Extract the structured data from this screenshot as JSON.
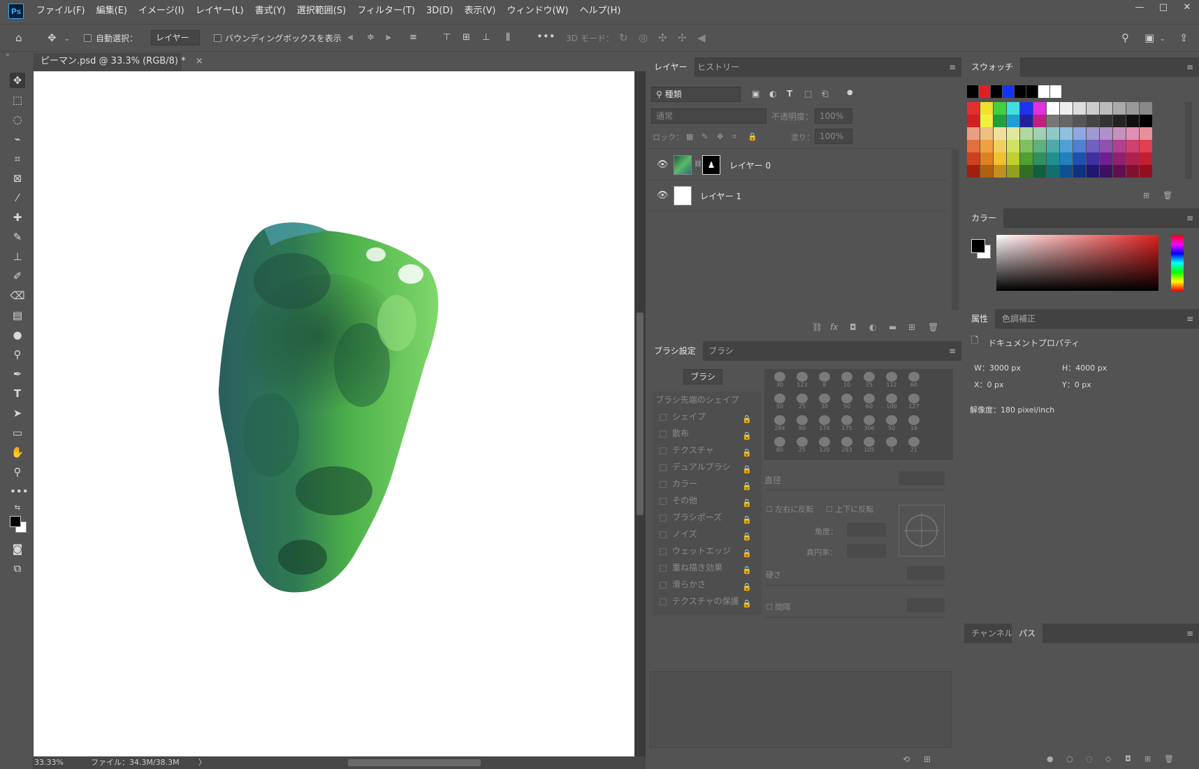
{
  "app": {
    "logo": "Ps"
  },
  "menu": [
    "ファイル(F)",
    "編集(E)",
    "イメージ(I)",
    "レイヤー(L)",
    "書式(Y)",
    "選択範囲(S)",
    "フィルター(T)",
    "3D(D)",
    "表示(V)",
    "ウィンドウ(W)",
    "ヘルプ(H)"
  ],
  "window_controls": [
    "—",
    "□",
    "✕"
  ],
  "options": {
    "auto_select_label": "自動選択：",
    "auto_select_target": "レイヤー",
    "bounding_box_label": "バウンディングボックスを表示",
    "threeD_mode_label": "3D モード："
  },
  "document": {
    "tab_title": "ピーマン.psd @ 33.3% (RGB/8) *",
    "close": "×"
  },
  "status": {
    "zoom": "33.33%",
    "file_info": "ファイル：34.3M/38.3M",
    "arrow": "〉"
  },
  "layers_panel": {
    "tabs": [
      "レイヤー",
      "ヒストリー"
    ],
    "filter_kind": "種類",
    "blend_mode": "通常",
    "opacity_label": "不透明度：",
    "opacity_value": "100%",
    "lock_label": "ロック：",
    "fill_label": "塗り：",
    "fill_value": "100%",
    "layers": [
      {
        "name": "レイヤー 0"
      },
      {
        "name": "レイヤー 1"
      }
    ]
  },
  "brush_panel": {
    "tabs": [
      "ブラシ設定",
      "ブラシ"
    ],
    "brush_button": "ブラシ",
    "tip_shape": "ブラシ先端のシェイプ",
    "options": [
      "シェイプ",
      "散布",
      "テクスチャ",
      "デュアルブラシ",
      "カラー",
      "その他",
      "ブラシポーズ",
      "ノイズ",
      "ウェットエッジ",
      "重ね描き効果",
      "滑らかさ",
      "テクスチャの保護"
    ],
    "brush_sizes": [
      "30",
      "123",
      "8",
      "10",
      "25",
      "112",
      "60",
      "50",
      "25",
      "30",
      "50",
      "60",
      "100",
      "127",
      "284",
      "80",
      "174",
      "175",
      "306",
      "50",
      "16",
      "80",
      "25",
      "120",
      "283",
      "105",
      "3",
      "21"
    ],
    "diameter_label": "直径",
    "flip_x_label": "左右に反転",
    "flip_y_label": "上下に反転",
    "angle_label": "角度：",
    "roundness_label": "真円率：",
    "hardness_label": "硬さ",
    "spacing_label": "間隔"
  },
  "swatches_panel": {
    "tab": "スウォッチ",
    "recent": [
      "#000000",
      "#e02020",
      "#000000",
      "#1432ff",
      "#000000",
      "#000000",
      "#ffffff",
      "#ffffff"
    ],
    "rows": [
      [
        "#e03030",
        "#f0e030",
        "#40d040",
        "#40e0e0",
        "#2030f0",
        "#e030e0",
        "#ffffff",
        "#eeeeee",
        "#dddddd",
        "#cccccc",
        "#bbbbbb",
        "#aaaaaa",
        "#999999",
        "#888888"
      ],
      [
        "#d02020",
        "#f0f040",
        "#20a040",
        "#20a0d0",
        "#2020a0",
        "#c02080",
        "#777777",
        "#666666",
        "#555555",
        "#444444",
        "#333333",
        "#222222",
        "#111111",
        "#000000"
      ],
      [
        "#e8a080",
        "#f0c080",
        "#f0e0a0",
        "#e0e8a0",
        "#b0d8a0",
        "#a0d0b0",
        "#90c8c8",
        "#90c0e0",
        "#90a8e0",
        "#a098d0",
        "#b090c8",
        "#c890c0",
        "#e090b0",
        "#e89098"
      ],
      [
        "#e07040",
        "#f0a040",
        "#f0d060",
        "#d0e060",
        "#80c060",
        "#60b080",
        "#50a8a8",
        "#50a0d8",
        "#5080d0",
        "#7060c0",
        "#9050b0",
        "#b04090",
        "#d04070",
        "#e04050"
      ],
      [
        "#d04020",
        "#e08020",
        "#f0c030",
        "#c0d030",
        "#50a030",
        "#309060",
        "#209090",
        "#2080c0",
        "#2050b0",
        "#4030a0",
        "#702090",
        "#902070",
        "#b02050",
        "#c02030"
      ],
      [
        "#a02010",
        "#b06010",
        "#c09020",
        "#90a020",
        "#307020",
        "#106040",
        "#107070",
        "#105090",
        "#103080",
        "#201870",
        "#401060",
        "#601050",
        "#801030",
        "#901020"
      ]
    ]
  },
  "color_panel": {
    "tab": "カラー"
  },
  "properties_panel": {
    "tabs": [
      "属性",
      "色調補正"
    ],
    "title": "ドキュメントプロパティ",
    "w": "W：3000 px",
    "h": "H：4000 px",
    "x": "X：0 px",
    "y": "Y：0 px",
    "resolution": "解像度：180 pixel/inch"
  },
  "paths_panel": {
    "tabs": [
      "チャンネル",
      "パス"
    ]
  }
}
